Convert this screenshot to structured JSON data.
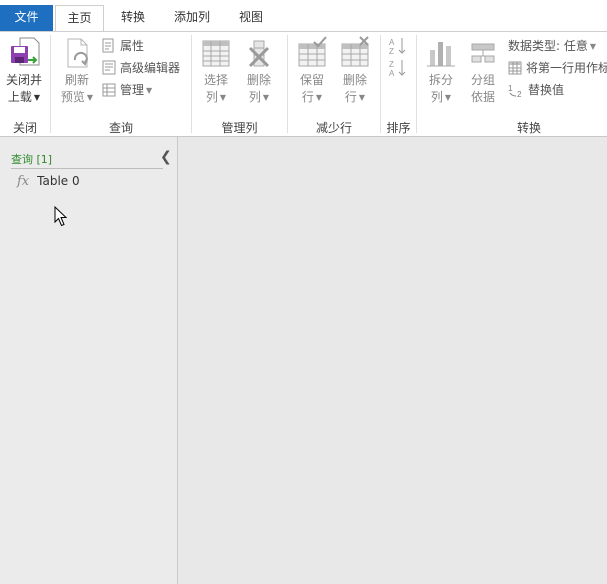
{
  "tabs": [
    {
      "label": "文件"
    },
    {
      "label": "主页"
    },
    {
      "label": "转换"
    },
    {
      "label": "添加列"
    },
    {
      "label": "视图"
    }
  ],
  "ribbon": {
    "groups": {
      "close": "关闭",
      "query": "查询",
      "manage_columns": "管理列",
      "reduce_rows": "减少行",
      "sort": "排序",
      "transform": "转换"
    },
    "close_load": {
      "line1": "关闭并",
      "line2": "上载"
    },
    "refresh": {
      "line1": "刷新",
      "line2": "预览"
    },
    "properties": "属性",
    "advanced_editor": "高级编辑器",
    "manage": "管理",
    "choose_columns": {
      "line1": "选择",
      "line2": "列"
    },
    "remove_columns": {
      "line1": "删除",
      "line2": "列"
    },
    "keep_rows": {
      "line1": "保留",
      "line2": "行"
    },
    "remove_rows": {
      "line1": "删除",
      "line2": "行"
    },
    "split_column": {
      "line1": "拆分",
      "line2": "列"
    },
    "group_by": {
      "line1": "分组",
      "line2": "依据"
    },
    "data_type": "数据类型: 任意",
    "first_row_header": "将第一行用作标",
    "replace_values": "替换值"
  },
  "query_panel": {
    "header": "查询 [1]",
    "items": [
      {
        "icon": "fx",
        "name": "Table 0"
      }
    ]
  },
  "colors": {
    "file_tab": "#1e6fbf",
    "query_header": "#2e8b2e"
  }
}
